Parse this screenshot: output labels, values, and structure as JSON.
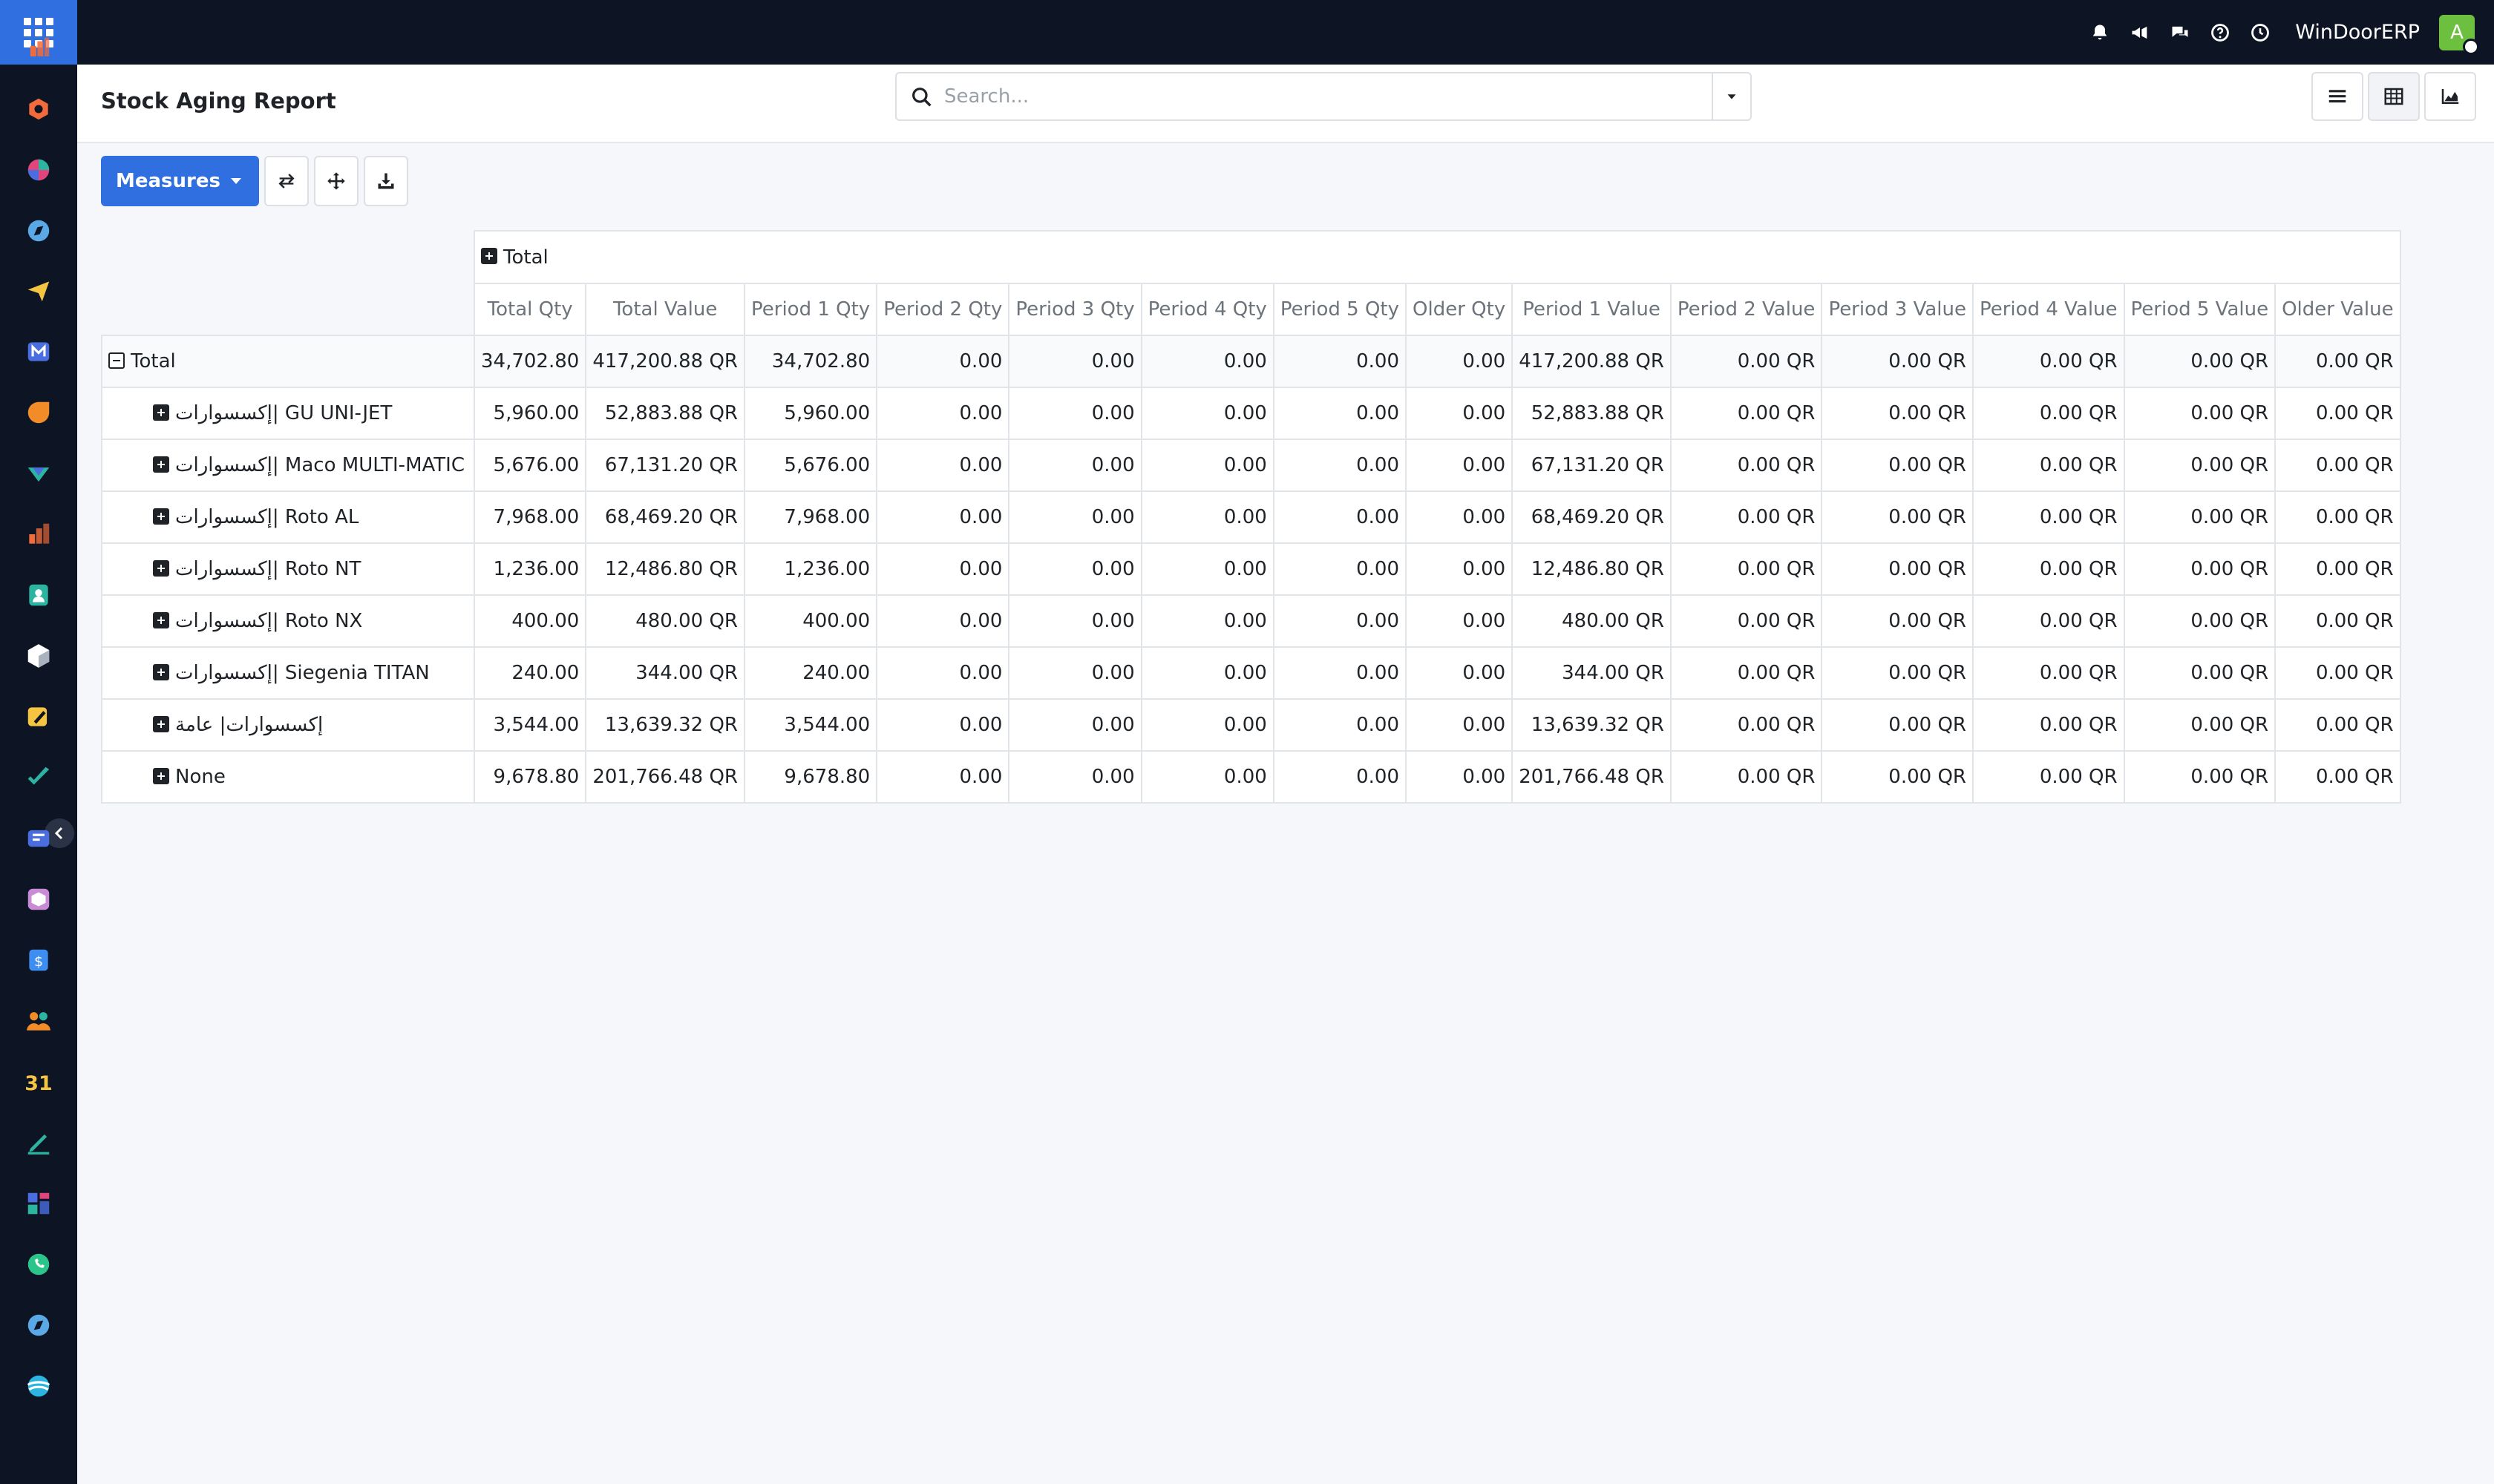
{
  "navbar": {
    "company": "WinDoorERP",
    "user_initial": "A",
    "icons": [
      "bell-icon",
      "megaphone-icon",
      "chat-icon",
      "help-icon",
      "clock-icon"
    ]
  },
  "sidebar": {
    "items": [
      {
        "name": "dashboards-app-icon",
        "color": "#f26b3a"
      },
      {
        "name": "odoo-shape-icon",
        "color": "#f26b3a"
      },
      {
        "name": "pie-app-icon",
        "color": "#e0457b"
      },
      {
        "name": "compass-app-icon",
        "color": "#5aa9e6"
      },
      {
        "name": "send-app-icon",
        "color": "#f5c542"
      },
      {
        "name": "mail-m-app-icon",
        "color": "#4a6ee0"
      },
      {
        "name": "chat-bubble-app-icon",
        "color": "#f28c28"
      },
      {
        "name": "discuss-app-icon",
        "color": "#2bb5a0"
      },
      {
        "name": "bar-chart-app-icon",
        "color": "#f26b3a"
      },
      {
        "name": "contacts-app-icon",
        "color": "#2bb5a0"
      },
      {
        "name": "inventory-box-icon",
        "color": "#ffffff"
      },
      {
        "name": "sign-app-icon",
        "color": "#f5c542"
      },
      {
        "name": "project-check-icon",
        "color": "#2bb5a0"
      },
      {
        "name": "knowledge-book-icon",
        "color": "#4a6ee0"
      },
      {
        "name": "package-app-icon",
        "color": "#c98bd6"
      },
      {
        "name": "invoice-dollar-icon",
        "color": "#3d8ef0"
      },
      {
        "name": "team-people-icon",
        "color": "#f28c28"
      },
      {
        "name": "calendar-31-icon",
        "color": "#f5c542"
      },
      {
        "name": "pen-app-icon",
        "color": "#2bb5a0"
      },
      {
        "name": "tiles-app-icon",
        "color": "#4a6ee0"
      },
      {
        "name": "whatsapp-icon",
        "color": "#2bc48a"
      },
      {
        "name": "compass-2-app-icon",
        "color": "#5aa9e6"
      },
      {
        "name": "website-app-icon",
        "color": "#2bb5e0"
      }
    ]
  },
  "control": {
    "title": "Stock Aging Report",
    "search_placeholder": "Search...",
    "search_value": ""
  },
  "toolbar": {
    "measures_label": "Measures"
  },
  "pivot": {
    "col_total": "Total",
    "measures": [
      "Total Qty",
      "Total Value",
      "Period 1 Qty",
      "Period 2 Qty",
      "Period 3 Qty",
      "Period 4 Qty",
      "Period 5 Qty",
      "Older Qty",
      "Period 1 Value",
      "Period 2 Value",
      "Period 3 Value",
      "Period 4 Value",
      "Period 5 Value",
      "Older Value"
    ],
    "total_row": {
      "label": "Total",
      "values": [
        "34,702.80",
        "417,200.88 QR",
        "34,702.80",
        "0.00",
        "0.00",
        "0.00",
        "0.00",
        "0.00",
        "417,200.88 QR",
        "0.00 QR",
        "0.00 QR",
        "0.00 QR",
        "0.00 QR",
        "0.00 QR"
      ]
    },
    "rows": [
      {
        "label": "إكسسوارات| GU UNI-JET",
        "values": [
          "5,960.00",
          "52,883.88 QR",
          "5,960.00",
          "0.00",
          "0.00",
          "0.00",
          "0.00",
          "0.00",
          "52,883.88 QR",
          "0.00 QR",
          "0.00 QR",
          "0.00 QR",
          "0.00 QR",
          "0.00 QR"
        ]
      },
      {
        "label": "إكسسوارات| Maco MULTI-MATIC",
        "values": [
          "5,676.00",
          "67,131.20 QR",
          "5,676.00",
          "0.00",
          "0.00",
          "0.00",
          "0.00",
          "0.00",
          "67,131.20 QR",
          "0.00 QR",
          "0.00 QR",
          "0.00 QR",
          "0.00 QR",
          "0.00 QR"
        ]
      },
      {
        "label": "إكسسوارات| Roto AL",
        "values": [
          "7,968.00",
          "68,469.20 QR",
          "7,968.00",
          "0.00",
          "0.00",
          "0.00",
          "0.00",
          "0.00",
          "68,469.20 QR",
          "0.00 QR",
          "0.00 QR",
          "0.00 QR",
          "0.00 QR",
          "0.00 QR"
        ]
      },
      {
        "label": "إكسسوارات| Roto NT",
        "values": [
          "1,236.00",
          "12,486.80 QR",
          "1,236.00",
          "0.00",
          "0.00",
          "0.00",
          "0.00",
          "0.00",
          "12,486.80 QR",
          "0.00 QR",
          "0.00 QR",
          "0.00 QR",
          "0.00 QR",
          "0.00 QR"
        ]
      },
      {
        "label": "إكسسوارات| Roto NX",
        "values": [
          "400.00",
          "480.00 QR",
          "400.00",
          "0.00",
          "0.00",
          "0.00",
          "0.00",
          "0.00",
          "480.00 QR",
          "0.00 QR",
          "0.00 QR",
          "0.00 QR",
          "0.00 QR",
          "0.00 QR"
        ]
      },
      {
        "label": "إكسسوارات| Siegenia TITAN",
        "values": [
          "240.00",
          "344.00 QR",
          "240.00",
          "0.00",
          "0.00",
          "0.00",
          "0.00",
          "0.00",
          "344.00 QR",
          "0.00 QR",
          "0.00 QR",
          "0.00 QR",
          "0.00 QR",
          "0.00 QR"
        ]
      },
      {
        "label": "إكسسوارات| عامة",
        "values": [
          "3,544.00",
          "13,639.32 QR",
          "3,544.00",
          "0.00",
          "0.00",
          "0.00",
          "0.00",
          "0.00",
          "13,639.32 QR",
          "0.00 QR",
          "0.00 QR",
          "0.00 QR",
          "0.00 QR",
          "0.00 QR"
        ]
      },
      {
        "label": "None",
        "values": [
          "9,678.80",
          "201,766.48 QR",
          "9,678.80",
          "0.00",
          "0.00",
          "0.00",
          "0.00",
          "0.00",
          "201,766.48 QR",
          "0.00 QR",
          "0.00 QR",
          "0.00 QR",
          "0.00 QR",
          "0.00 QR"
        ]
      }
    ]
  }
}
